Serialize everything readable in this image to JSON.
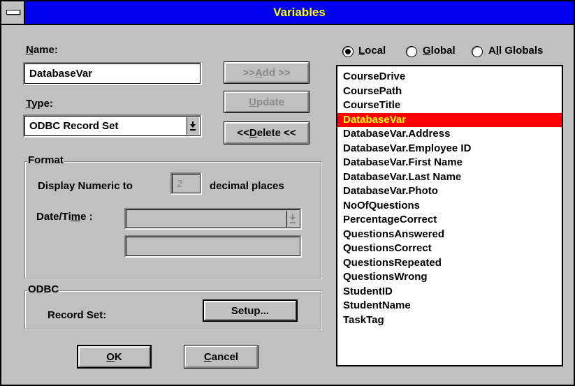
{
  "window": {
    "title": "Variables"
  },
  "name": {
    "label_u": "N",
    "label_rest": "ame:",
    "value": "DatabaseVar"
  },
  "type": {
    "label_u": "T",
    "label_rest": "ype:",
    "value": "ODBC Record Set"
  },
  "buttons": {
    "add": {
      "pre": ">> ",
      "u": "A",
      "post": "dd >>"
    },
    "update": {
      "u": "U",
      "post": "pdate"
    },
    "delete": {
      "pre": "<< ",
      "u": "D",
      "post": "elete <<"
    },
    "setup": "Setup...",
    "ok": {
      "u": "O",
      "post": "K"
    },
    "cancel": {
      "u": "C",
      "post": "ancel"
    }
  },
  "format": {
    "group_label": "Format",
    "display_numeric_label": "Display Numeric to",
    "decimal_value": "2",
    "decimal_suffix": "decimal places",
    "datetime_label_pre": "Date/Ti",
    "datetime_label_u": "m",
    "datetime_label_post": "e :",
    "datetime_value": "",
    "datetime_sample": ""
  },
  "odbc": {
    "group_label": "ODBC",
    "record_set_label": "Record Set:"
  },
  "scope": {
    "local": {
      "u": "L",
      "post": "ocal",
      "selected": true
    },
    "global": {
      "u": "G",
      "post": "lobal",
      "selected": false
    },
    "all_globals": {
      "pre": "A",
      "u": "l",
      "post": "l Globals",
      "selected": false
    }
  },
  "variables": [
    "CourseDrive",
    "CoursePath",
    "CourseTitle",
    "DatabaseVar",
    "DatabaseVar.Address",
    "DatabaseVar.Employee ID",
    "DatabaseVar.First Name",
    "DatabaseVar.Last Name",
    "DatabaseVar.Photo",
    "NoOfQuestions",
    "PercentageCorrect",
    "QuestionsAnswered",
    "QuestionsCorrect",
    "QuestionsRepeated",
    "QuestionsWrong",
    "StudentID",
    "StudentName",
    "TaskTag"
  ],
  "selected_variable_index": 3,
  "colors": {
    "titlebar": "#0000f0",
    "title_text": "#ffff00",
    "selection": "#ff0000",
    "selection_text": "#ffff00",
    "face": "#c0c0c0"
  }
}
